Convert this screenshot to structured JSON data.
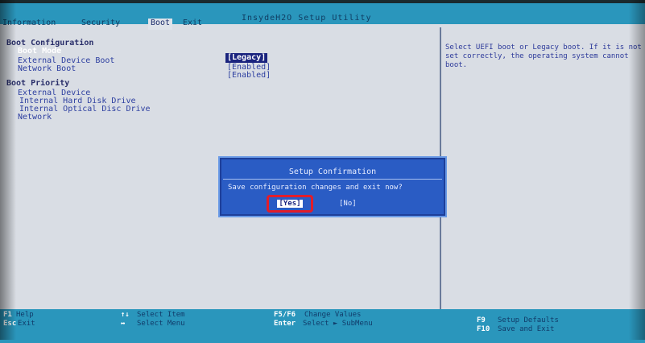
{
  "header": {
    "title": "InsydeH2O Setup Utility",
    "tabs": [
      "Information",
      "Security",
      "Boot",
      "Exit"
    ],
    "active_tab": "Boot"
  },
  "boot": {
    "section_config": "Boot Configuration",
    "boot_mode_label": "Boot Mode",
    "boot_mode_value": "[Legacy]",
    "external_boot_label": "External Device Boot",
    "external_boot_value": "[Enabled]",
    "network_boot_label": "Network Boot",
    "network_boot_value": "[Enabled]",
    "section_priority": "Boot Priority",
    "priority_items": [
      "External Device",
      "Internal Hard Disk Drive",
      "Internal Optical Disc Drive",
      "Network"
    ]
  },
  "help": {
    "text": "Select UEFI boot or Legacy boot. If it is not set correctly, the operating system cannot boot."
  },
  "dialog": {
    "title": "Setup Confirmation",
    "message": "Save configuration changes and exit now?",
    "yes_label": "[Yes]",
    "no_label": "[No]"
  },
  "footer": {
    "keys": [
      {
        "key": "F1",
        "label": "Help"
      },
      {
        "key": "Esc",
        "label": "Exit"
      },
      {
        "key": "↑↓",
        "label": "Select Item"
      },
      {
        "key": "↔",
        "label": "Select Menu"
      },
      {
        "key": "F5/F6",
        "label": "Change Values"
      },
      {
        "key": "Enter",
        "label": "Select ► SubMenu"
      },
      {
        "key": "F9",
        "label": "Setup Defaults"
      },
      {
        "key": "F10",
        "label": "Save and Exit"
      }
    ]
  },
  "colors": {
    "bar": "#2a96bc",
    "panel": "#d9dde4",
    "dialog": "#2a5cc4",
    "highlight": "#e21d2a"
  }
}
